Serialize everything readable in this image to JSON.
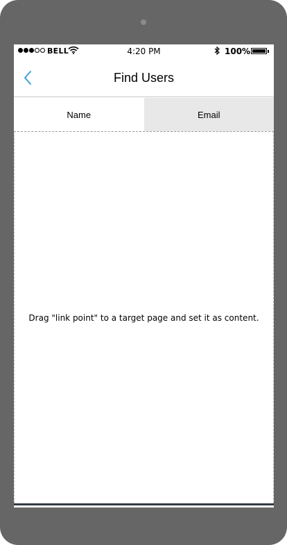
{
  "status_bar": {
    "carrier": "BELL",
    "time": "4:20 PM",
    "battery": "100%",
    "signal_dots_filled": 3,
    "signal_dots_total": 5
  },
  "nav": {
    "title": "Find Users",
    "back_icon": "chevron-left-icon",
    "accent_color": "#3aa0d8"
  },
  "tabs": [
    {
      "label": "Name",
      "active": true
    },
    {
      "label": "Email",
      "active": false
    }
  ],
  "content": {
    "hint": "Drag \"link point\" to a target page and set it as content."
  }
}
